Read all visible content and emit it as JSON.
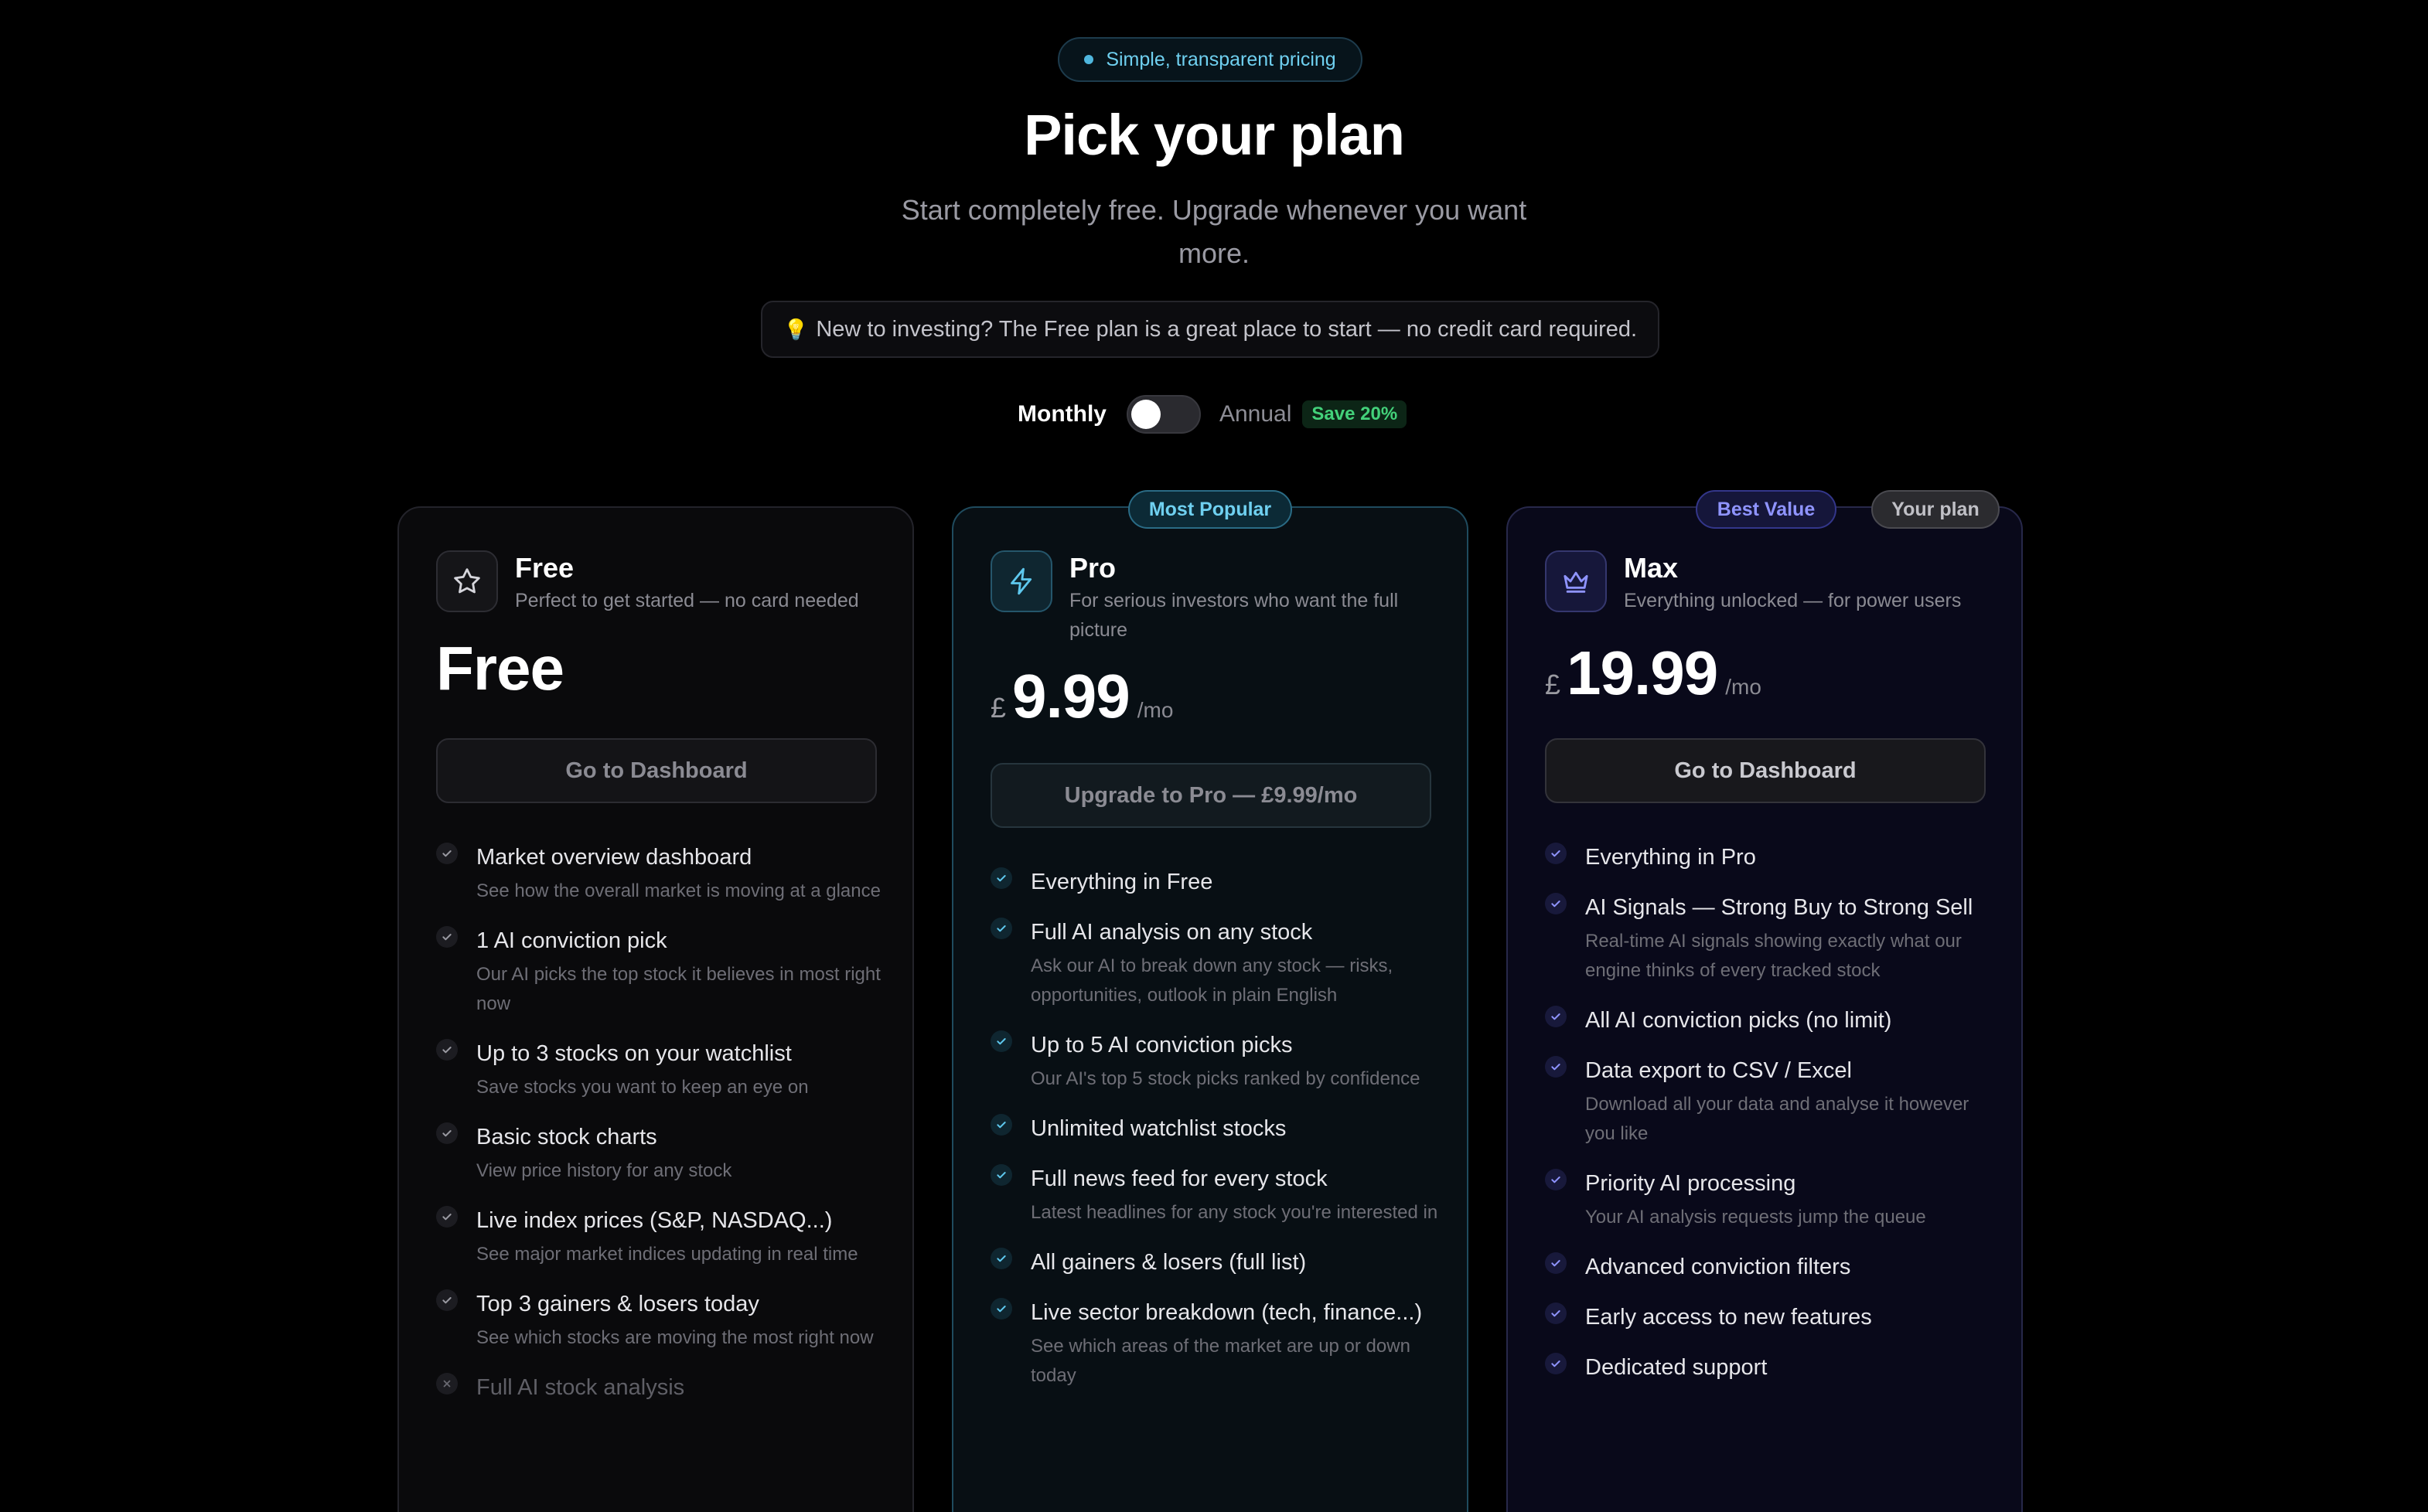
{
  "header": {
    "badge": "Simple, transparent pricing",
    "title": "Pick your plan",
    "subtitle": "Start completely free. Upgrade whenever you want more.",
    "note": "New to investing? The Free plan is a great place to start — no credit card required."
  },
  "billing": {
    "monthly_label": "Monthly",
    "annual_label": "Annual",
    "save_badge": "Save 20%",
    "annual_selected": false
  },
  "colors": {
    "background": "#000000",
    "accent_cyan": "#6fd0f0",
    "accent_violet": "#8f94ff",
    "save_green": "#43d17a"
  },
  "plans": {
    "free": {
      "icon": "star-icon",
      "name": "Free",
      "description": "Perfect to get started — no card needed",
      "price": "Free",
      "cta": "Go to Dashboard",
      "features": [
        {
          "title": "Market overview dashboard",
          "sub": "See how the overall market is moving at a glance"
        },
        {
          "title": "1 AI conviction pick",
          "sub": "Our AI picks the top stock it believes in most right now"
        },
        {
          "title": "Up to 3 stocks on your watchlist",
          "sub": "Save stocks you want to keep an eye on"
        },
        {
          "title": "Basic stock charts",
          "sub": "View price history for any stock"
        },
        {
          "title": "Live index prices (S&P, NASDAQ...)",
          "sub": "See major market indices updating in real time"
        },
        {
          "title": "Top 3 gainers & losers today",
          "sub": "See which stocks are moving the most right now"
        },
        {
          "title": "Full AI stock analysis",
          "sub": ""
        }
      ]
    },
    "pro": {
      "ribbon": "Most Popular",
      "icon": "lightning-icon",
      "name": "Pro",
      "description": "For serious investors who want the full picture",
      "currency": "£",
      "price": "9.99",
      "period": "/mo",
      "cta": "Upgrade to Pro — £9.99/mo",
      "features": [
        {
          "title": "Everything in Free",
          "sub": ""
        },
        {
          "title": "Full AI analysis on any stock",
          "sub": "Ask our AI to break down any stock — risks, opportunities, outlook in plain English"
        },
        {
          "title": "Up to 5 AI conviction picks",
          "sub": "Our AI's top 5 stock picks ranked by confidence"
        },
        {
          "title": "Unlimited watchlist stocks",
          "sub": ""
        },
        {
          "title": "Full news feed for every stock",
          "sub": "Latest headlines for any stock you're interested in"
        },
        {
          "title": "All gainers & losers (full list)",
          "sub": ""
        },
        {
          "title": "Live sector breakdown (tech, finance...)",
          "sub": "See which areas of the market are up or down today"
        }
      ]
    },
    "max": {
      "ribbon": "Best Value",
      "current_badge": "Your plan",
      "icon": "crown-icon",
      "name": "Max",
      "description": "Everything unlocked — for power users",
      "currency": "£",
      "price": "19.99",
      "period": "/mo",
      "cta": "Go to Dashboard",
      "features": [
        {
          "title": "Everything in Pro",
          "sub": ""
        },
        {
          "title": "AI Signals — Strong Buy to Strong Sell",
          "sub": "Real-time AI signals showing exactly what our engine thinks of every tracked stock"
        },
        {
          "title": "All AI conviction picks (no limit)",
          "sub": ""
        },
        {
          "title": "Data export to CSV / Excel",
          "sub": "Download all your data and analyse it however you like"
        },
        {
          "title": "Priority AI processing",
          "sub": "Your AI analysis requests jump the queue"
        },
        {
          "title": "Advanced conviction filters",
          "sub": ""
        },
        {
          "title": "Early access to new features",
          "sub": ""
        },
        {
          "title": "Dedicated support",
          "sub": ""
        }
      ]
    }
  }
}
